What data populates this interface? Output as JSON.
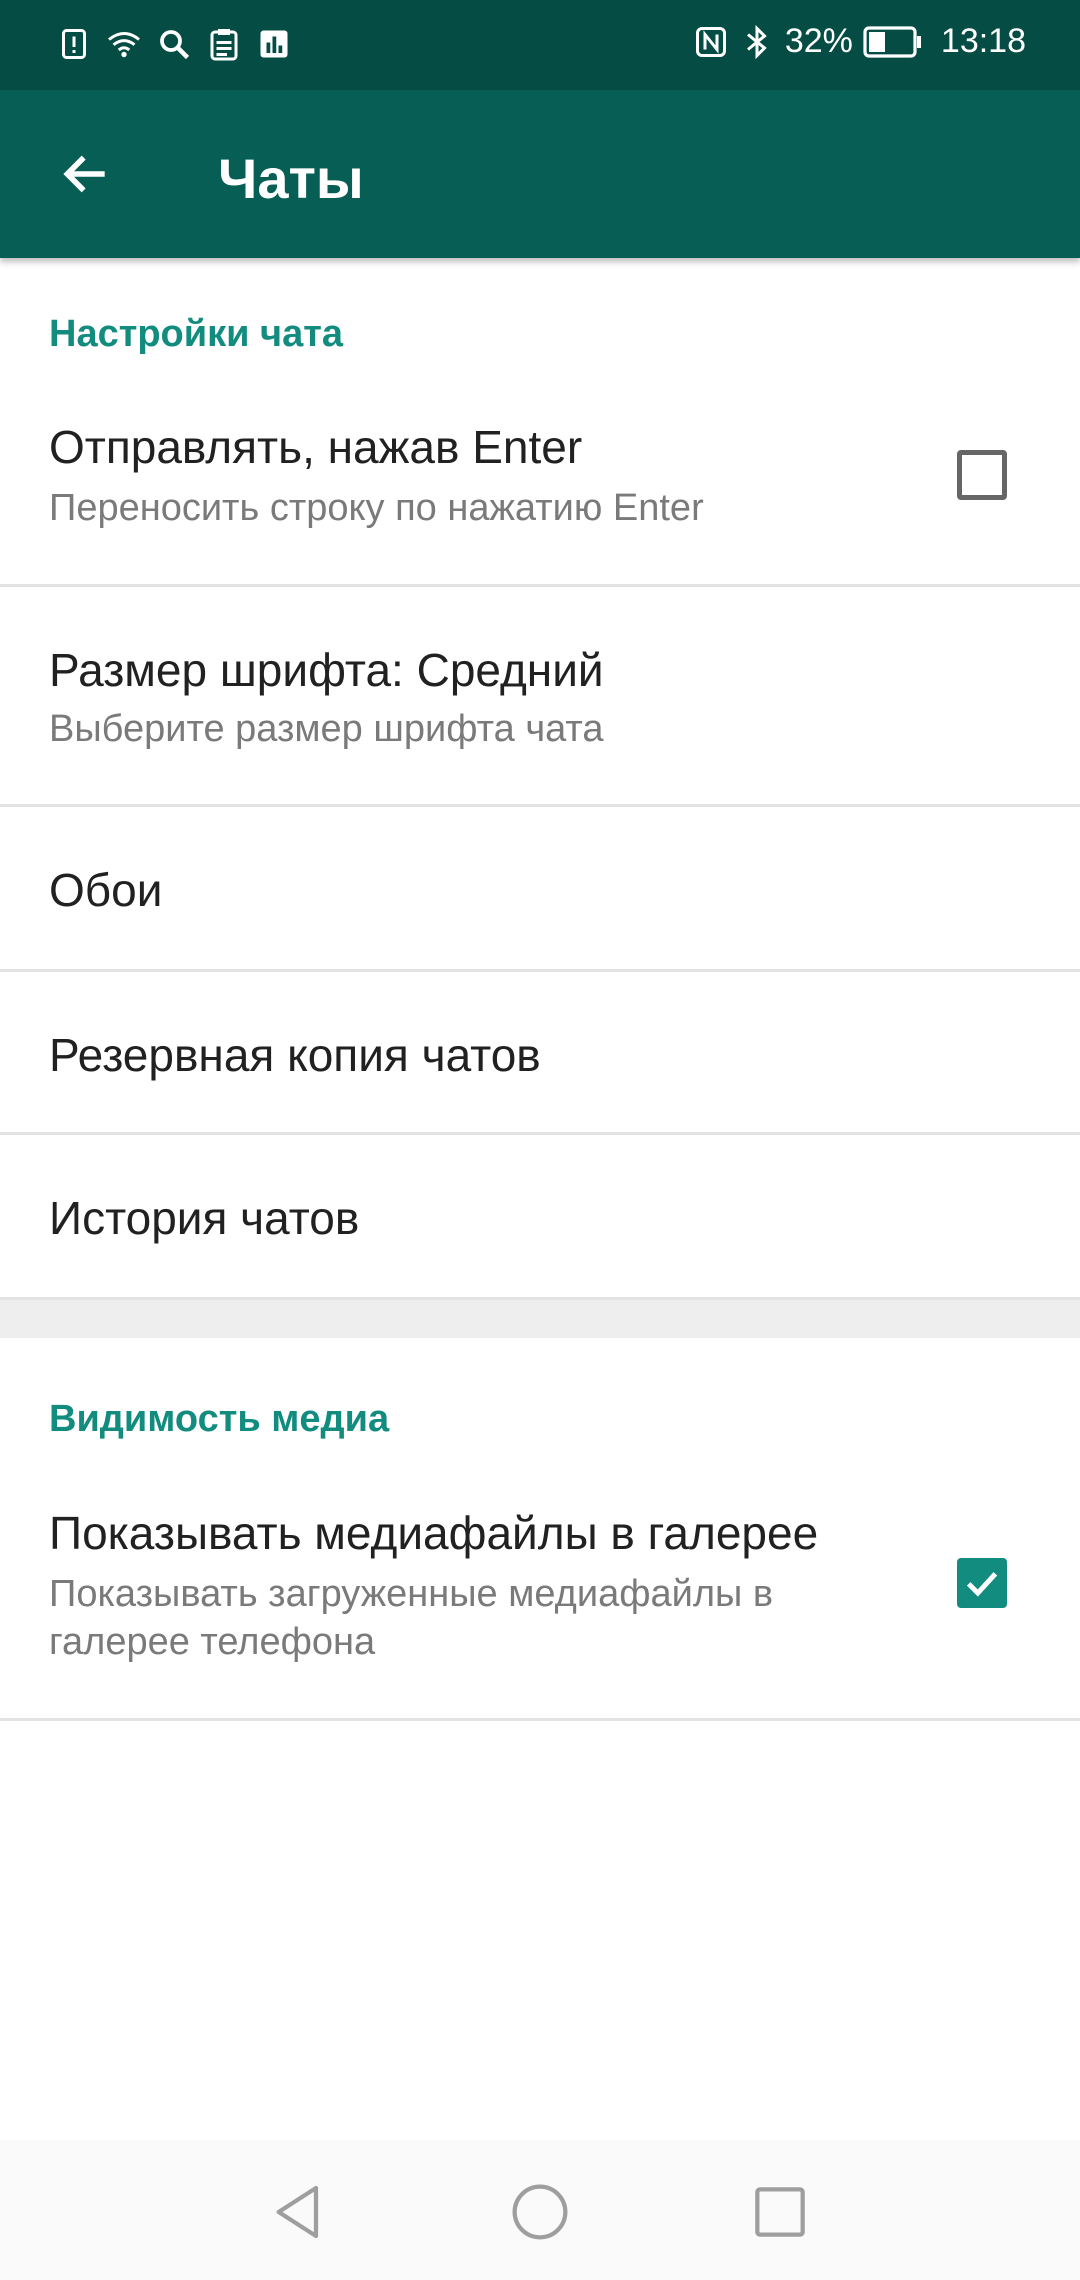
{
  "status_bar": {
    "battery": "32%",
    "time": "13:18",
    "left_icons": [
      "alert-icon",
      "wifi-icon",
      "search-icon",
      "clipboard-icon",
      "chart-icon"
    ],
    "right_icons": [
      "nfc-icon",
      "bluetooth-icon",
      "battery-icon"
    ]
  },
  "app_bar": {
    "title": "Чаты",
    "back_icon": "arrow-left-icon"
  },
  "sections": {
    "chat_settings": {
      "header": "Настройки чата",
      "items": {
        "enter_send": {
          "title": "Отправлять, нажав Enter",
          "subtitle": "Переносить строку по нажатию Enter",
          "checked": false
        },
        "font_size": {
          "title": "Размер шрифта: Средний",
          "subtitle": "Выберите размер шрифта чата"
        },
        "wallpaper": {
          "title": "Обои"
        },
        "backup": {
          "title": "Резервная копия чатов"
        },
        "history": {
          "title": "История чатов"
        }
      }
    },
    "media_visibility": {
      "header": "Видимость медиа",
      "items": {
        "show_media": {
          "title": "Показывать медиафайлы в галерее",
          "subtitle_line1": "Показывать загруженные медиафайлы в",
          "subtitle_line2": "галерее телефона",
          "checked": true
        }
      }
    }
  },
  "colors": {
    "status_bar": "#054d44",
    "app_bar": "#075e54",
    "accent": "#128c7e"
  },
  "nav_bar": {
    "buttons": [
      "back-triangle-icon",
      "home-circle-icon",
      "recents-square-icon"
    ]
  }
}
